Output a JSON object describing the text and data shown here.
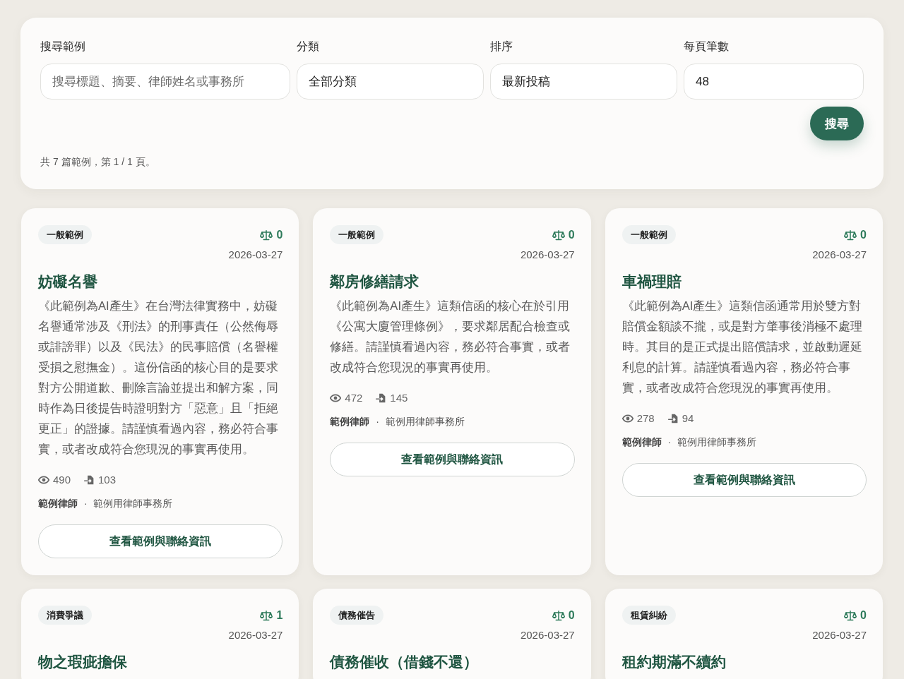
{
  "search_form": {
    "fields": [
      {
        "label": "搜尋範例",
        "placeholder": "搜尋標題、摘要、律師姓名或事務所"
      },
      {
        "label": "分類",
        "value": "全部分類"
      },
      {
        "label": "排序",
        "value": "最新投稿"
      },
      {
        "label": "每頁筆數",
        "value": "48"
      }
    ],
    "search_button": "搜尋",
    "result_summary": "共 7 篇範例，第 1 / 1 頁。"
  },
  "cards": [
    {
      "category": "一般範例",
      "score": "0",
      "date": "2026-03-27",
      "title": "妨礙名譽",
      "description": "《此範例為AI產生》在台灣法律實務中，妨礙名譽通常涉及《刑法》的刑事責任（公然侮辱或誹謗罪）以及《民法》的民事賠償（名譽權受損之慰撫金）。這份信函的核心目的是要求對方公開道歉、刪除言論並提出和解方案，同時作為日後提告時證明對方「惡意」且「拒絕更正」的證據。請謹慎看過內容，務必符合事實，或者改成符合您現況的事實再使用。",
      "views": "490",
      "uses": "103",
      "author": "**範例律師** · 範例用律師事務所",
      "button": "查看範例與聯絡資訊"
    },
    {
      "category": "一般範例",
      "score": "0",
      "date": "2026-03-27",
      "title": "鄰房修繕請求",
      "description": "《此範例為AI產生》這類信函的核心在於引用《公寓大廈管理條例》，要求鄰居配合檢查或修繕。請謹慎看過內容，務必符合事實，或者改成符合您現況的事實再使用。",
      "views": "472",
      "uses": "145",
      "author": "**範例律師** · 範例用律師事務所",
      "button": "查看範例與聯絡資訊"
    },
    {
      "category": "一般範例",
      "score": "0",
      "date": "2026-03-27",
      "title": "車禍理賠",
      "description": "《此範例為AI產生》這類信函通常用於雙方對賠償金額談不攏，或是對方肇事後消極不處理時。其目的是正式提出賠償請求，並啟動遲延利息的計算。請謹慎看過內容，務必符合事實，或者改成符合您現況的事實再使用。",
      "views": "278",
      "uses": "94",
      "author": "**範例律師** · 範例用律師事務所",
      "button": "查看範例與聯絡資訊"
    },
    {
      "category": "消費爭議",
      "score": "1",
      "date": "2026-03-27",
      "title": "物之瑕疵擔保"
    },
    {
      "category": "債務催告",
      "score": "0",
      "date": "2026-03-27",
      "title": "債務催收（借錢不還）"
    },
    {
      "category": "租賃糾紛",
      "score": "0",
      "date": "2026-03-27",
      "title": "租約期滿不續約"
    }
  ]
}
